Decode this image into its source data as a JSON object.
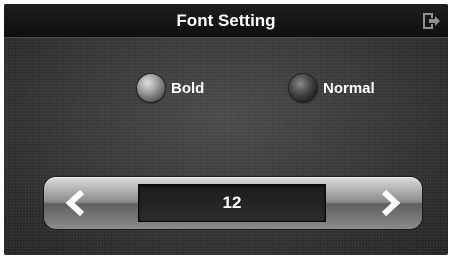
{
  "header": {
    "title": "Font Setting",
    "exit_icon": "exit-icon"
  },
  "font_style": {
    "options": [
      {
        "label": "Bold",
        "selected": false
      },
      {
        "label": "Normal",
        "selected": true
      }
    ]
  },
  "font_size": {
    "value": "12",
    "decrease_icon": "arrow-left-icon",
    "increase_icon": "arrow-right-icon"
  }
}
